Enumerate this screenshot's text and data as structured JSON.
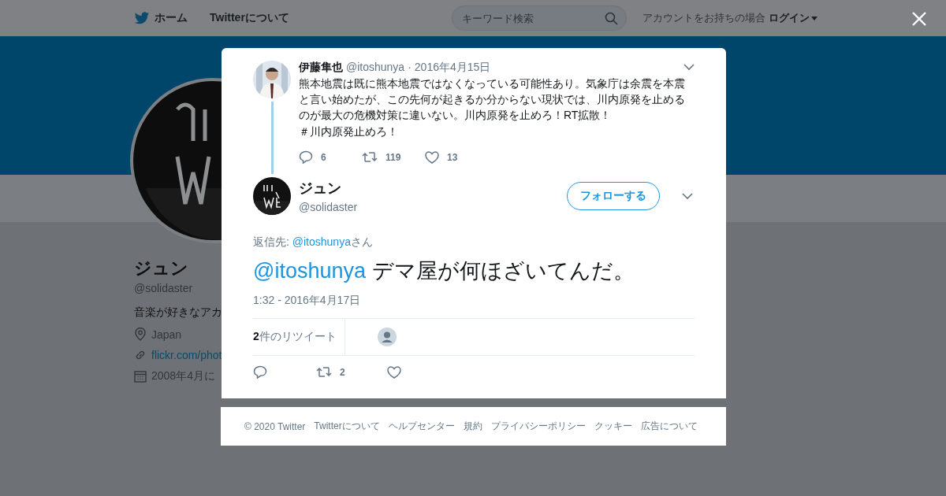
{
  "nav": {
    "items": [
      {
        "label": "ホーム"
      },
      {
        "label": "Twitterについて"
      }
    ],
    "search": {
      "placeholder": "キーワード検索"
    },
    "login_prompt": "アカウントをお持ちの場合",
    "login": "ログイン"
  },
  "profile": {
    "name": "ジュン",
    "handle": "@solidaster",
    "bio": "音楽が好きなアカ",
    "location": "Japan",
    "link": "flickr.com/phot",
    "joined": "2008年4月に"
  },
  "parent_tweet": {
    "name": "伊藤隼也",
    "handle": "@itoshunya",
    "separator": "·",
    "date": "2016年4月15日",
    "text": "熊本地震は既に熊本地震ではなくなっている可能性あり。気象庁は余震を本震と言い始めたが、この先何が起きるか分からない現状では、川内原発を止めるのが最大の危機対策に違いない。川内原発を止めろ！RT拡散！",
    "hashtag": "＃川内原発止めろ！",
    "actions": [
      {
        "kind": "reply",
        "count": "6"
      },
      {
        "kind": "retweet",
        "count": "119"
      },
      {
        "kind": "like",
        "count": "13"
      }
    ]
  },
  "tweet": {
    "name": "ジュン",
    "handle": "@solidaster",
    "follow": "フォローする",
    "reply_to_label": "返信先:",
    "reply_to_handle": "@itoshunya",
    "reply_to_suffix": "さん",
    "mention": "@itoshunya",
    "text": "デマ屋が何ほざいてんだ。",
    "time": "1:32 - 2016年4月17日",
    "retweets": "**2**件のリツイート",
    "actions": [
      {
        "kind": "reply"
      },
      {
        "kind": "retweet",
        "count": "2"
      },
      {
        "kind": "like"
      }
    ]
  },
  "footer": [
    "© 2020 Twitter",
    "Twitterについて",
    "ヘルプセンター",
    "規約",
    "プライバシーポリシー",
    "クッキー",
    "広告について"
  ]
}
